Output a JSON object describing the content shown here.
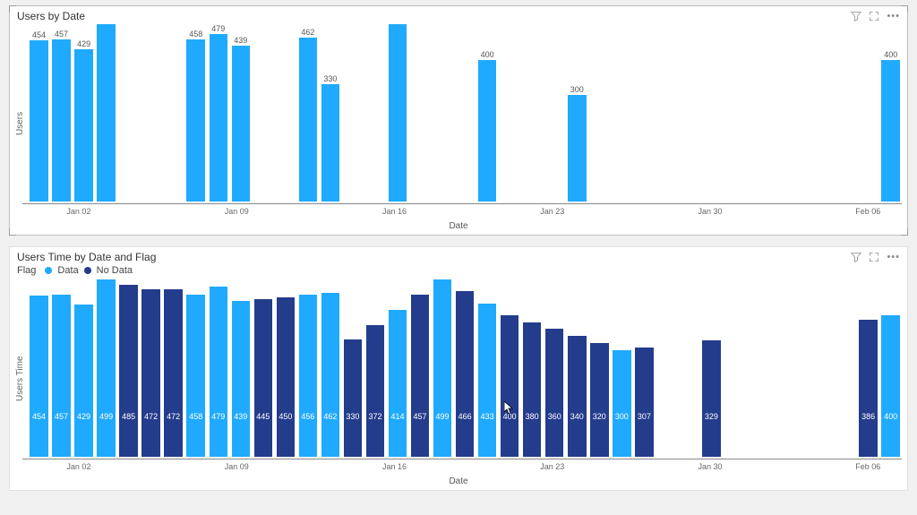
{
  "chart_data": [
    {
      "id": "top",
      "type": "bar",
      "title": "Users by Date",
      "xlabel": "Date",
      "ylabel": "Users",
      "ylim": [
        0,
        500
      ],
      "xticks": [
        "Jan 02",
        "Jan 09",
        "Jan 16",
        "Jan 23",
        "Jan 30",
        "Feb 06"
      ],
      "categories": [
        "Dec 31",
        "Jan 01",
        "Jan 02",
        "Jan 03",
        "Jan 04",
        "Jan 05",
        "Jan 06",
        "Jan 07",
        "Jan 08",
        "Jan 09",
        "Jan 10",
        "Jan 11",
        "Jan 12",
        "Jan 13",
        "Jan 14",
        "Jan 15",
        "Jan 16",
        "Jan 17",
        "Jan 18",
        "Jan 19",
        "Jan 20",
        "Jan 21",
        "Jan 22",
        "Jan 23",
        "Jan 24",
        "Jan 25",
        "Jan 26",
        "Jan 27",
        "Jan 28",
        "Jan 29",
        "Jan 30",
        "Jan 31",
        "Feb 01",
        "Feb 02",
        "Feb 03",
        "Feb 04",
        "Feb 05",
        "Feb 06",
        "Feb 07"
      ],
      "values": [
        454,
        457,
        429,
        500,
        null,
        null,
        null,
        458,
        479,
        439,
        null,
        null,
        462,
        330,
        null,
        null,
        500,
        null,
        null,
        null,
        400,
        null,
        null,
        null,
        300,
        null,
        null,
        null,
        null,
        null,
        null,
        null,
        null,
        null,
        null,
        null,
        null,
        null,
        400
      ],
      "data_labels": [
        "454",
        "457",
        "429",
        "",
        null,
        null,
        null,
        "458",
        "479",
        "439",
        null,
        null,
        "462",
        "330",
        null,
        null,
        "",
        null,
        null,
        null,
        "400",
        null,
        null,
        null,
        "300",
        null,
        null,
        null,
        null,
        null,
        null,
        null,
        null,
        null,
        null,
        null,
        null,
        null,
        "400"
      ]
    },
    {
      "id": "bottom",
      "type": "bar",
      "title": "Users Time by Date and Flag",
      "xlabel": "Date",
      "ylabel": "Users Time",
      "ylim": [
        0,
        500
      ],
      "legend_title": "Flag",
      "legend": [
        "Data",
        "No Data"
      ],
      "colors": {
        "Data": "#1faaff",
        "No Data": "#243c8c"
      },
      "xticks": [
        "Jan 02",
        "Jan 09",
        "Jan 16",
        "Jan 23",
        "Jan 30",
        "Feb 06"
      ],
      "categories": [
        "Dec 31",
        "Jan 01",
        "Jan 02",
        "Jan 03",
        "Jan 04",
        "Jan 05",
        "Jan 06",
        "Jan 07",
        "Jan 08",
        "Jan 09",
        "Jan 10",
        "Jan 11",
        "Jan 12",
        "Jan 13",
        "Jan 14",
        "Jan 15",
        "Jan 16",
        "Jan 17",
        "Jan 18",
        "Jan 19",
        "Jan 20",
        "Jan 21",
        "Jan 22",
        "Jan 23",
        "Jan 24",
        "Jan 25",
        "Jan 26",
        "Jan 27",
        "Jan 28",
        "Jan 29",
        "Jan 30",
        "Jan 31",
        "Feb 01",
        "Feb 02",
        "Feb 03",
        "Feb 04",
        "Feb 05",
        "Feb 06",
        "Feb 07"
      ],
      "series": [
        {
          "name": "flag",
          "values": [
            "Data",
            "Data",
            "Data",
            "Data",
            "No Data",
            "No Data",
            "No Data",
            "Data",
            "Data",
            "Data",
            "No Data",
            "No Data",
            "Data",
            "Data",
            "No Data",
            "No Data",
            "Data",
            "No Data",
            "Data",
            "No Data",
            "Data",
            "No Data",
            "No Data",
            "No Data",
            "No Data",
            "No Data",
            "Data",
            "No Data",
            null,
            null,
            "No Data",
            null,
            null,
            null,
            null,
            null,
            null,
            "No Data",
            "Data"
          ]
        },
        {
          "name": "value",
          "values": [
            454,
            457,
            429,
            499,
            485,
            472,
            472,
            458,
            479,
            439,
            445,
            450,
            456,
            462,
            330,
            372,
            414,
            457,
            499,
            466,
            433,
            400,
            380,
            360,
            340,
            320,
            300,
            307,
            null,
            null,
            329,
            null,
            null,
            null,
            null,
            null,
            null,
            386,
            400
          ]
        }
      ]
    }
  ]
}
